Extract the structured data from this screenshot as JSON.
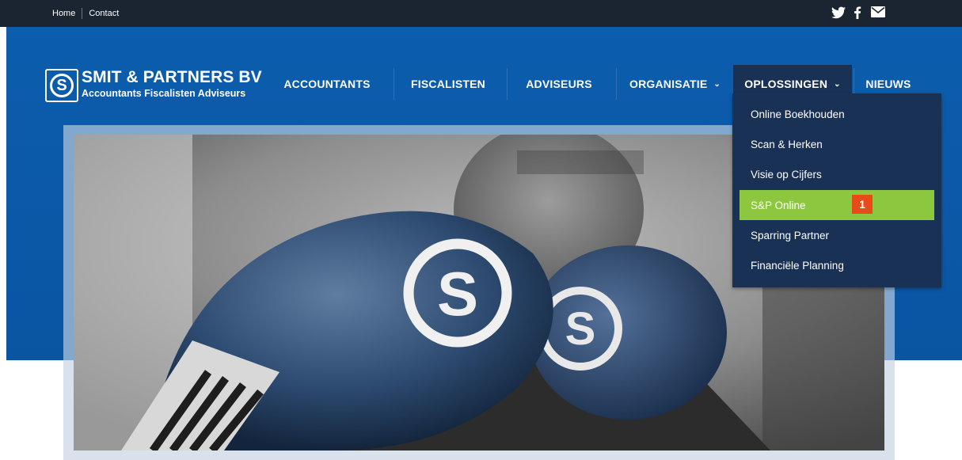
{
  "topbar": {
    "links": [
      "Home",
      "Contact"
    ],
    "social_icons": [
      "twitter-icon",
      "facebook-icon",
      "mail-icon"
    ]
  },
  "logo": {
    "mark": "S",
    "name": "SMIT & PARTNERS BV",
    "tagline": "Accountants Fiscalisten Adviseurs"
  },
  "nav": {
    "items": [
      {
        "label": "ACCOUNTANTS"
      },
      {
        "label": "FISCALISTEN"
      },
      {
        "label": "ADVISEURS"
      },
      {
        "label": "ORGANISATIE"
      },
      {
        "label": "OPLOSSINGEN"
      },
      {
        "label": "NIEUWS"
      }
    ]
  },
  "dropdown": {
    "items": [
      {
        "label": "Online Boekhouden"
      },
      {
        "label": "Scan & Herken"
      },
      {
        "label": "Visie op Cijfers"
      },
      {
        "label": "S&P Online",
        "highlighted": true,
        "badge": "1"
      },
      {
        "label": "Sparring Partner"
      },
      {
        "label": "Financiële Planning"
      }
    ]
  },
  "hero": {
    "glove_logo": "S"
  },
  "colors": {
    "topbar": "#1b2532",
    "band": "#0b5aa8",
    "dropdown": "#1a3156",
    "highlight": "#8dc63f",
    "badge": "#e84b17"
  }
}
